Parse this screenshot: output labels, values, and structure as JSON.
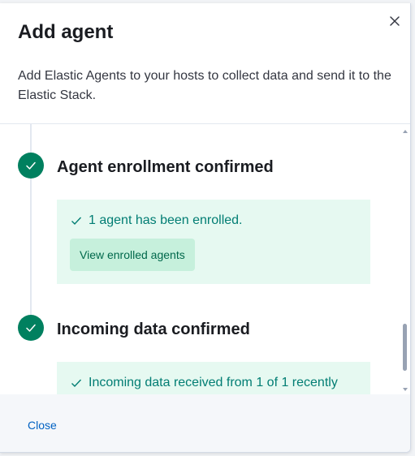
{
  "flyout": {
    "title": "Add agent",
    "subtitle": "Add Elastic Agents to your hosts to collect data and send it to the Elastic Stack."
  },
  "steps": [
    {
      "title": "Agent enrollment confirmed",
      "status": "complete",
      "callout_text": "1 agent has been enrolled.",
      "button_label": "View enrolled agents"
    },
    {
      "title": "Incoming data confirmed",
      "status": "complete",
      "callout_text": "Incoming data received from 1 of 1 recently"
    }
  ],
  "footer": {
    "close_label": "Close"
  },
  "colors": {
    "success": "#00805f",
    "callout_bg": "#e6f9f1",
    "callout_text": "#017d73",
    "link": "#0061c2"
  }
}
